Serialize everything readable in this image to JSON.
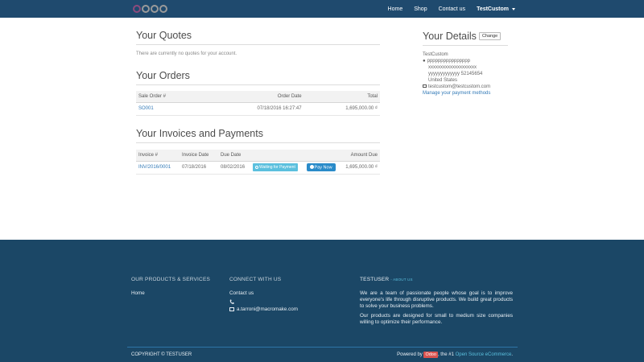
{
  "nav": {
    "logo_text": "odoo",
    "links": [
      "Home",
      "Shop",
      "Contact us"
    ],
    "user": "TestCustom"
  },
  "quotes": {
    "title": "Your Quotes",
    "empty_text": "There are currently no quotes for your account."
  },
  "orders": {
    "title": "Your Orders",
    "columns": [
      "Sale Order #",
      "Order Date",
      "Total"
    ],
    "rows": [
      {
        "number": "SO001",
        "date": "07/18/2016 16:27:47",
        "total": "1,695,000.00 ₫"
      }
    ]
  },
  "invoices": {
    "title": "Your Invoices and Payments",
    "columns": [
      "Invoice #",
      "Invoice Date",
      "Due Date",
      "Amount Due"
    ],
    "rows": [
      {
        "number": "INV/2016/0001",
        "date": "07/18/2016",
        "due": "08/02/2016",
        "status": "Waiting for Payment",
        "pay_label": "Pay Now",
        "amount": "1,695,000.00 ₫"
      }
    ]
  },
  "details": {
    "title": "Your Details",
    "change_label": "Change",
    "name": "TestCustom",
    "line1": "pppppppppppppppp",
    "line2": "xxxxxxxxxxxxxxxxxxxx",
    "line3": "yyyyyyyyyyyyy 52145654",
    "country": "United States",
    "email": "testcustom@testcustom.com",
    "payment_link": "Manage your payment methods"
  },
  "footer": {
    "col1_title": "OUR PRODUCTS & SERVICES",
    "col1_link": "Home",
    "col2_title": "CONNECT WITH US",
    "col2_link": "Contact us",
    "col2_email": "a.tarroni@macromake.com",
    "col3_title": "TESTUSER",
    "col3_about": "- ABOUT US",
    "about_p1": "We are a team of passionate people whose goal is to improve everyone's life through disruptive products. We build great products to solve your business problems.",
    "about_p2": "Our products are designed for small to medium size companies willing to optimize their performance.",
    "copyright": "COPYRIGHT © TESTUSER",
    "powered_prefix": "Powered by",
    "powered_badge": "Odoo",
    "powered_mid": ", the #1",
    "powered_link": "Open Source eCommerce",
    "powered_suffix": "."
  },
  "colors": {
    "navbar": "#1f4a6e",
    "footer": "#1b4766",
    "link": "#337ab7",
    "info": "#5bc0de",
    "primary": "#2a8bc9"
  }
}
